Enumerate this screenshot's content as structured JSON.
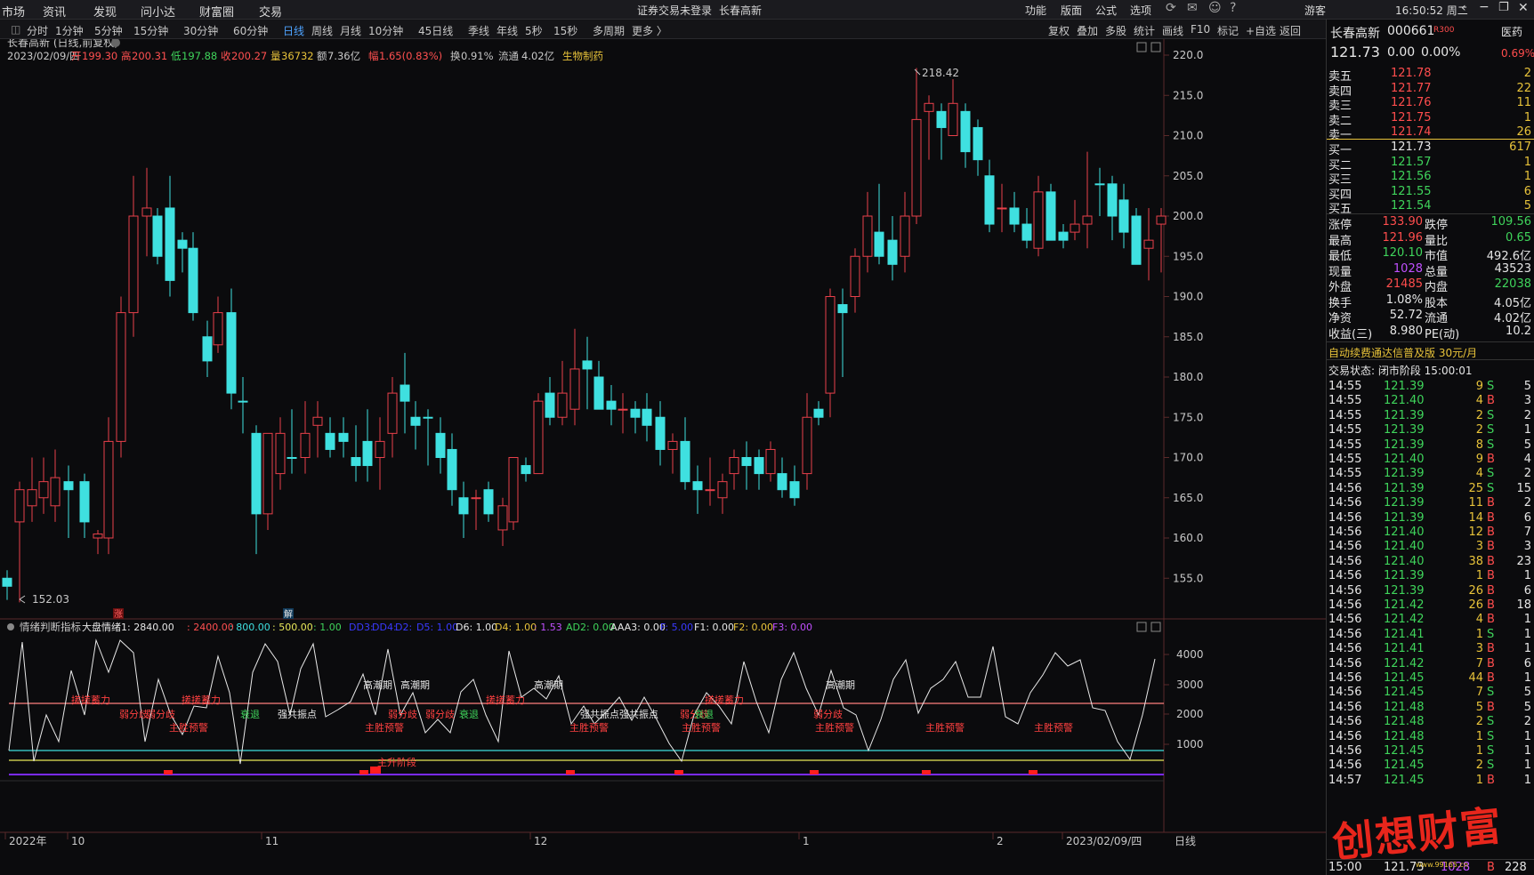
{
  "menu": {
    "market": "市场",
    "info": "资讯",
    "discover": "发现",
    "wenxiaoda": "问小达",
    "caifuquan": "财富圈",
    "trade": "交易",
    "alert": "证券交易未登录",
    "stockname_alert": "长春高新",
    "func": "功能",
    "layout": "版面",
    "formula": "公式",
    "options": "选项",
    "guest": "游客",
    "time": "16:50:52 周二"
  },
  "periods": [
    "分时",
    "1分钟",
    "5分钟",
    "15分钟",
    "30分钟",
    "60分钟",
    "日线",
    "周线",
    "月线",
    "10分钟",
    "45日线",
    "季线",
    "年线",
    "5秒",
    "15秒",
    "多周期",
    "更多 〉"
  ],
  "active_period": "日线",
  "rightTools": [
    "复权",
    "叠加",
    "多股",
    "统计",
    "画线",
    "F10",
    "标记",
    "+自选",
    "返回"
  ],
  "chart": {
    "title": "长春高新 (日线,前复权)",
    "date": "2023/02/09/四",
    "open_label": "开",
    "open": "199.30",
    "high_label": "高",
    "high": "200.31",
    "low_label": "低",
    "low": "197.88",
    "close_label": "收",
    "close": "200.27",
    "vol_label": "量",
    "vol": "36732",
    "amt_label": "额",
    "amt": "7.36亿",
    "range_label": "幅",
    "range": "1.65(0.83%)",
    "turn_label": "换",
    "turn": "0.91%",
    "float_label": "流通",
    "float": "4.02亿",
    "industry": "生物制药",
    "ymax_label": "218.42",
    "ymin_label": "152.03",
    "yticks": [
      "220.0",
      "215.0",
      "210.0",
      "205.0",
      "200.0",
      "195.0",
      "190.0",
      "185.0",
      "180.0",
      "175.0",
      "170.0",
      "165.0",
      "160.0",
      "155.0"
    ],
    "xlabels": [
      "2022年",
      "10",
      "11",
      "12",
      "1",
      "2",
      "2023/02/09/四"
    ],
    "marker_zhang": "涨",
    "marker_jie": "解",
    "period_label": "日线"
  },
  "indicator": {
    "name": "情绪判断指标",
    "items": [
      {
        "t": "大盘情绪1: 2840.00",
        "c": "#e6e6e6"
      },
      {
        "t": ": 2400.00",
        "c": "#ff5050"
      },
      {
        "t": ": 800.00",
        "c": "#3fe0e0"
      },
      {
        "t": ": 500.00",
        "c": "#e8e85a"
      },
      {
        "t": ": 1.00",
        "c": "#3fd45b"
      },
      {
        "t": "DD3:",
        "c": "#3a3aff"
      },
      {
        "t": "DD4:",
        "c": "#3a3aff"
      },
      {
        "t": "D2:",
        "c": "#3a3aff"
      },
      {
        "t": "D5: 1.00",
        "c": "#3a3aff"
      },
      {
        "t": "D6: 1.00",
        "c": "#e6e6e6"
      },
      {
        "t": "D4: 1.00",
        "c": "#e8c33a"
      },
      {
        "t": ": 1.53",
        "c": "#c050ff"
      },
      {
        "t": "AD2: 0.00",
        "c": "#3fd45b"
      },
      {
        "t": "AAA3: 0.00",
        "c": "#e6e6e6"
      },
      {
        "t": "F: 5.00",
        "c": "#3a3aff"
      },
      {
        "t": "F1: 0.00",
        "c": "#e6e6e6"
      },
      {
        "t": "F2: 0.00",
        "c": "#e8c33a"
      },
      {
        "t": "F3: 0.00",
        "c": "#c050ff"
      }
    ],
    "yticks": [
      "4000",
      "3000",
      "2000",
      "1000"
    ],
    "labels": {
      "gcq": "高潮期",
      "rfq": "弱分歧",
      "zjcl": "搓搓蓄力",
      "zsyj": "主胜预警",
      "sh": "衰退",
      "qgzd": "强共振点",
      "zsjd": "主升阶段"
    }
  },
  "quote": {
    "name": "长春高新",
    "code": "000661",
    "badge": "R300",
    "sector": "医药",
    "price": "121.73",
    "chg": "0.00",
    "pct": "0.00%",
    "sector_pct": "0.69%",
    "sells": [
      {
        "l": "卖五",
        "p": "121.78",
        "v": "2"
      },
      {
        "l": "卖四",
        "p": "121.77",
        "v": "22"
      },
      {
        "l": "卖三",
        "p": "121.76",
        "v": "11"
      },
      {
        "l": "卖二",
        "p": "121.75",
        "v": "1"
      },
      {
        "l": "卖一",
        "p": "121.74",
        "v": "26"
      }
    ],
    "buys": [
      {
        "l": "买一",
        "p": "121.73",
        "v": "617"
      },
      {
        "l": "买二",
        "p": "121.57",
        "v": "1"
      },
      {
        "l": "买三",
        "p": "121.56",
        "v": "1"
      },
      {
        "l": "买四",
        "p": "121.55",
        "v": "6"
      },
      {
        "l": "买五",
        "p": "121.54",
        "v": "5"
      }
    ],
    "stats": [
      {
        "a": "涨停",
        "b": "133.90",
        "bc": "red",
        "c": "跌停",
        "d": "109.56",
        "dc": "green"
      },
      {
        "a": "最高",
        "b": "121.96",
        "bc": "red",
        "c": "量比",
        "d": "0.65",
        "dc": "green"
      },
      {
        "a": "最低",
        "b": "120.10",
        "bc": "green",
        "c": "市值",
        "d": "492.6亿",
        "dc": "white"
      },
      {
        "a": "现量",
        "b": "1028",
        "bc": "purple",
        "c": "总量",
        "d": "43523",
        "dc": "white"
      },
      {
        "a": "外盘",
        "b": "21485",
        "bc": "red",
        "c": "内盘",
        "d": "22038",
        "dc": "green"
      },
      {
        "a": "换手",
        "b": "1.08%",
        "bc": "white",
        "c": "股本",
        "d": "4.05亿",
        "dc": "white"
      },
      {
        "a": "净资",
        "b": "52.72",
        "bc": "white",
        "c": "流通",
        "d": "4.02亿",
        "dc": "white"
      },
      {
        "a": "收益(三)",
        "b": "8.980",
        "bc": "white",
        "c": "PE(动)",
        "d": "10.2",
        "dc": "white"
      }
    ],
    "ad": "自动续费通达信普及版   30元/月",
    "status": "交易状态: 闭市阶段 15:00:01",
    "ticks": [
      [
        "14:55",
        "121.39",
        "9",
        "S",
        "5"
      ],
      [
        "14:55",
        "121.40",
        "4",
        "B",
        "3"
      ],
      [
        "14:55",
        "121.39",
        "2",
        "S",
        "2"
      ],
      [
        "14:55",
        "121.39",
        "2",
        "S",
        "1"
      ],
      [
        "14:55",
        "121.39",
        "8",
        "S",
        "5"
      ],
      [
        "14:55",
        "121.40",
        "9",
        "B",
        "4"
      ],
      [
        "14:55",
        "121.39",
        "4",
        "S",
        "2"
      ],
      [
        "14:56",
        "121.39",
        "25",
        "S",
        "15"
      ],
      [
        "14:56",
        "121.39",
        "11",
        "B",
        "2"
      ],
      [
        "14:56",
        "121.39",
        "14",
        "B",
        "6"
      ],
      [
        "14:56",
        "121.40",
        "12",
        "B",
        "7"
      ],
      [
        "14:56",
        "121.40",
        "3",
        "B",
        "3"
      ],
      [
        "14:56",
        "121.40",
        "38",
        "B",
        "23"
      ],
      [
        "14:56",
        "121.39",
        "1",
        "B",
        "1"
      ],
      [
        "14:56",
        "121.39",
        "26",
        "B",
        "6"
      ],
      [
        "14:56",
        "121.42",
        "26",
        "B",
        "18"
      ],
      [
        "14:56",
        "121.42",
        "4",
        "B",
        "1"
      ],
      [
        "14:56",
        "121.41",
        "1",
        "S",
        "1"
      ],
      [
        "14:56",
        "121.41",
        "3",
        "B",
        "1"
      ],
      [
        "14:56",
        "121.42",
        "7",
        "B",
        "6"
      ],
      [
        "14:56",
        "121.45",
        "44",
        "B",
        "1"
      ],
      [
        "14:56",
        "121.45",
        "7",
        "S",
        "5"
      ],
      [
        "14:56",
        "121.48",
        "5",
        "B",
        "5"
      ],
      [
        "14:56",
        "121.48",
        "2",
        "S",
        "2"
      ],
      [
        "14:56",
        "121.48",
        "1",
        "S",
        "1"
      ],
      [
        "14:56",
        "121.45",
        "1",
        "S",
        "1"
      ],
      [
        "14:56",
        "121.45",
        "2",
        "S",
        "1"
      ],
      [
        "14:57",
        "121.45",
        "1",
        "B",
        "1"
      ]
    ],
    "last_row": [
      "15:00",
      "121.73",
      "1028",
      "B",
      "228"
    ],
    "watermark": "创想财富",
    "watermark_small": "www.99165.cn"
  }
}
